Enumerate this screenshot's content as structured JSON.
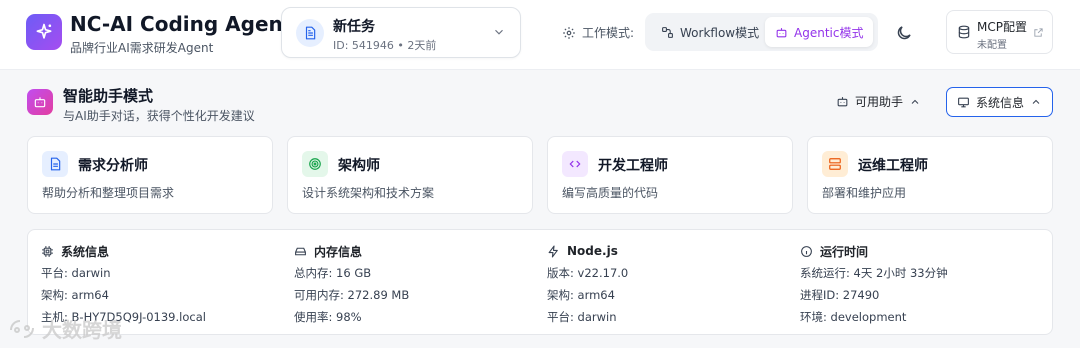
{
  "app": {
    "title": "NC-AI Coding Agent",
    "subtitle": "品牌行业AI需求研发Agent"
  },
  "task": {
    "name": "新任务",
    "meta": "ID: 541946  •  2天前"
  },
  "mode": {
    "label": "工作模式:",
    "workflow_label": "Workflow模式",
    "agentic_label": "Agentic模式",
    "active": "agentic"
  },
  "mcp": {
    "title": "MCP配置",
    "status": "未配置"
  },
  "section": {
    "title": "智能助手模式",
    "description": "与AI助手对话，获得个性化开发建议",
    "available_label": "可用助手",
    "sysinfo_label": "系统信息"
  },
  "roles": [
    {
      "name": "需求分析师",
      "description": "帮助分析和整理项目需求",
      "icon": "document-icon",
      "color": "#2563eb",
      "bg": "#e6efff"
    },
    {
      "name": "架构师",
      "description": "设计系统架构和技术方案",
      "icon": "target-icon",
      "color": "#16a34a",
      "bg": "#e4f7ea"
    },
    {
      "name": "开发工程师",
      "description": "编写高质量的代码",
      "icon": "code-icon",
      "color": "#9333ea",
      "bg": "#f3e8ff"
    },
    {
      "name": "运维工程师",
      "description": "部署和维护应用",
      "icon": "server-icon",
      "color": "#ea580c",
      "bg": "#ffedd5"
    }
  ],
  "sysinfo": {
    "system": {
      "title": "系统信息",
      "lines": [
        "平台: darwin",
        "架构: arm64",
        "主机: B-HY7D5Q9J-0139.local"
      ]
    },
    "memory": {
      "title": "内存信息",
      "lines": [
        "总内存: 16 GB",
        "可用内存: 272.89 MB",
        "使用率: 98%"
      ]
    },
    "node": {
      "title": "Node.js",
      "lines": [
        "版本: v22.17.0",
        "架构: arm64",
        "平台: darwin"
      ]
    },
    "uptime": {
      "title": "运行时间",
      "lines": [
        "系统运行: 4天 2小时 33分钟",
        "进程ID: 27490",
        "环境: development"
      ]
    }
  },
  "watermark": "大数跨境"
}
